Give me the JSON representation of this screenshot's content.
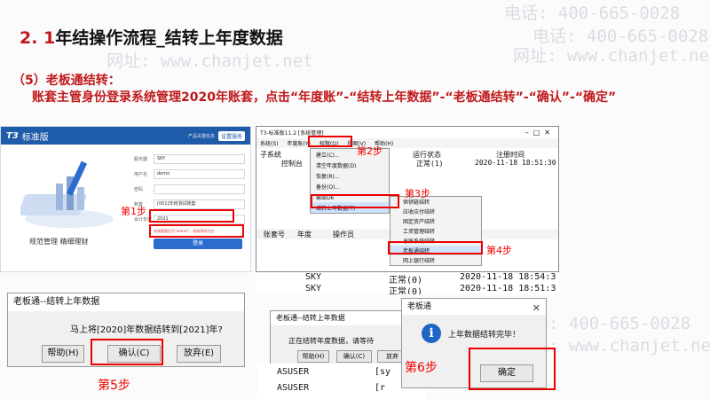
{
  "watermarks": [
    "电话: 400-665-0028",
    "网址: www.chanjet.net"
  ],
  "slide": {
    "title_num": "2. 1",
    "title_text": "年结操作流程_结转上年度数据",
    "step_head": "（5）老板通结转：",
    "step_desc": "账套主管身份登录系统管理2020年账套，点击“年度账”-“结转上年数据”-“老板通结转”-“确认”-“确定”"
  },
  "login": {
    "brand": "T3",
    "edition": "标准版",
    "tip": "产品关键信息",
    "settings_label": "设置服务",
    "server_label": "服务器",
    "server_value": "SKY",
    "user_label": "用户名",
    "user_value": "demo",
    "password_label": "密码",
    "account_label": "账套",
    "account_value": "[001]年结测试账套",
    "year_label": "会计年度",
    "year_value": "2021",
    "hint": "系统管理员为\"admin\"，初始密码为空",
    "login_button": "登录",
    "slogan": "规范管理 精细理财"
  },
  "sysmgr": {
    "title": "T3-标准版11.2 [系统管理]",
    "menu": [
      "系统(S)",
      "年度账(Y)",
      "权限(O)",
      "视图(V)",
      "帮助(H)"
    ],
    "table_headers": [
      "子系统",
      "运行状态",
      "注册时间"
    ],
    "table_row": [
      "控制台",
      "正常(1)",
      "2020-11-18 18:51:30"
    ],
    "lower_headers": [
      "账套号",
      "年度",
      "操作员"
    ],
    "year_menu_items": [
      "建立(C)...",
      "清空年度数据(D)",
      "恢复(R)...",
      "备份(O)...",
      "输出U6",
      "结转上年数据(T)"
    ],
    "carry_submenu": [
      "供销链结转",
      "应收应付结转",
      "固定资产结转",
      "工资管理结转",
      "总账系统结转",
      "老板通结转",
      "网上银行结转"
    ]
  },
  "strip": {
    "rows": [
      [
        "SKY",
        "正常(0)",
        "2020-11-18 18:54:3"
      ],
      [
        "SKY",
        "正常(0)",
        "2020-11-18 18:51:3"
      ]
    ]
  },
  "confirm_dialog": {
    "title": "老板通--结转上年数据",
    "message": "马上将[2020]年数据结转到[2021]年?",
    "help": "帮助(H)",
    "confirm": "确认(C)",
    "cancel": "放弃(E)"
  },
  "progress_dialog": {
    "title": "老板通--结转上年数据",
    "message": "正在结转年度数据，请等待",
    "help": "帮助(H)",
    "confirm": "确认(C)",
    "cancel": "放弃"
  },
  "done_dialog": {
    "title": "老板通",
    "message": "上年数据结转完毕！",
    "ok": "确定"
  },
  "asuser": {
    "rows": [
      [
        "ASUSER",
        "[sy"
      ],
      [
        "ASUSER",
        "[r"
      ]
    ]
  },
  "steps": [
    "第1步",
    "第2步",
    "第3步",
    "第4步",
    "第5步",
    "第6步"
  ],
  "colors": {
    "accent_red": "#c0191b",
    "box_red": "#e00000",
    "brand_blue": "#1e5ba8"
  }
}
